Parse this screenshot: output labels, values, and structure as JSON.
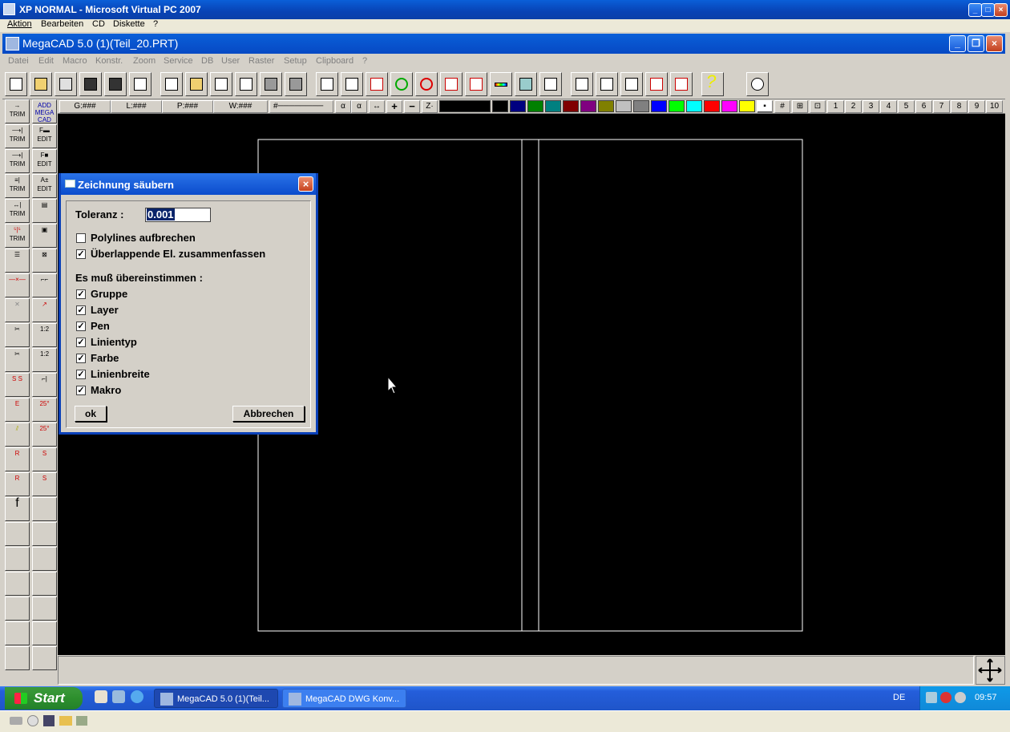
{
  "vpc": {
    "title": "XP NORMAL - Microsoft Virtual PC 2007",
    "menu": [
      "Aktion",
      "Bearbeiten",
      "CD",
      "Diskette",
      "?"
    ]
  },
  "app": {
    "title": "MegaCAD 5.0 (1)(Teil_20.PRT)",
    "menu": [
      "Datei",
      "Edit",
      "Macro",
      "Konstr.",
      "Zoom",
      "Service",
      "DB",
      "User",
      "Raster",
      "Setup",
      "Clipboard",
      "?"
    ]
  },
  "status": {
    "g": "G:###",
    "l": "L:###",
    "p": "P:###",
    "w": "W:###",
    "line": "#────────",
    "zoom_plus": "+",
    "zoom_minus": "−",
    "z": "Z·",
    "numbers": [
      "1",
      "2",
      "3",
      "4",
      "5",
      "6",
      "7",
      "8",
      "9",
      "10"
    ],
    "colors": [
      "#000000",
      "#000080",
      "#008000",
      "#008080",
      "#800000",
      "#800080",
      "#808000",
      "#c0c0c0",
      "#808080",
      "#0000ff",
      "#00ff00",
      "#00ffff",
      "#ff0000",
      "#ff00ff",
      "#ffff00",
      "#ffffff"
    ]
  },
  "left_tools": {
    "trim": "TRIM",
    "edit": "EDIT",
    "add_mega_cad": "ADD MEGA CAD"
  },
  "dialog": {
    "title": "Zeichnung säubern",
    "tolerance_label": "Toleranz :",
    "tolerance_value": "0.001",
    "polylines": "Polylines aufbrechen",
    "overlap": "Überlappende El. zusammenfassen",
    "match_header": "Es muß übereinstimmen :",
    "match_items": [
      "Gruppe",
      "Layer",
      "Pen",
      "Linientyp",
      "Farbe",
      "Linienbreite",
      "Makro"
    ],
    "ok": "ok",
    "cancel": "Abbrechen"
  },
  "taskbar": {
    "start": "Start",
    "task1": "MegaCAD 5.0 (1)(Teil...",
    "task2": "MegaCAD DWG Konv...",
    "lang": "DE",
    "clock": "09:57"
  }
}
